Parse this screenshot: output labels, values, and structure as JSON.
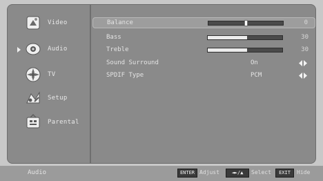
{
  "sidebar": {
    "items": [
      {
        "label": "Video",
        "icon": "video-icon",
        "selected": false
      },
      {
        "label": "Audio",
        "icon": "audio-icon",
        "selected": true
      },
      {
        "label": "TV",
        "icon": "tv-icon",
        "selected": false
      },
      {
        "label": "Setup",
        "icon": "setup-icon",
        "selected": false
      },
      {
        "label": "Parental",
        "icon": "parental-icon",
        "selected": false
      }
    ]
  },
  "audio": {
    "balance": {
      "label": "Balance",
      "value": "0",
      "level": 0.5
    },
    "bass": {
      "label": "Bass",
      "value": "30",
      "level": 0.53
    },
    "treble": {
      "label": "Treble",
      "value": "30",
      "level": 0.53
    },
    "sound_surround": {
      "label": "Sound Surround",
      "value": "On"
    },
    "spdif_type": {
      "label": "SPDIF Type",
      "value": "PCM"
    }
  },
  "footer": {
    "title": "Audio",
    "keys": [
      {
        "key": "ENTER",
        "label": "Adjust"
      },
      {
        "key": "◄►/▲",
        "label": "Select"
      },
      {
        "key": "EXIT",
        "label": "Hide"
      }
    ]
  },
  "colors": {
    "panel": "#8a8a8a",
    "highlight": "#9d9d9d",
    "text": "#e4e4e4",
    "bar_fill": "#ececec"
  }
}
